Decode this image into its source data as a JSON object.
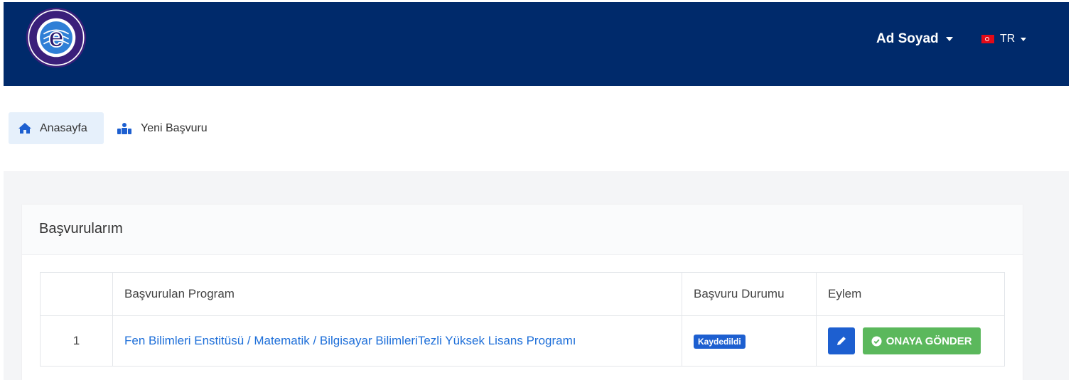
{
  "header": {
    "logo_text": "EGE ÜNİVERSİTESİ",
    "logo_year": "1955",
    "user_name": "Ad Soyad",
    "language": "TR"
  },
  "breadcrumb": {
    "home_label": "Anasayfa",
    "new_application_label": "Yeni Başvuru"
  },
  "card": {
    "title": "Başvurularım"
  },
  "table": {
    "columns": [
      "",
      "Başvurulan Program",
      "Başvuru Durumu",
      "Eylem"
    ],
    "rows": [
      {
        "no": "1",
        "program": "Fen Bilimleri Enstitüsü / Matematik / Bilgisayar BilimleriTezli Yüksek Lisans Programı",
        "status": "Kaydedildi",
        "action_label": "ONAYA GÖNDER"
      }
    ]
  },
  "colors": {
    "header_bg": "#002a6b",
    "primary": "#1d5fd0",
    "success": "#5bb85c",
    "link": "#1e6fd9"
  }
}
